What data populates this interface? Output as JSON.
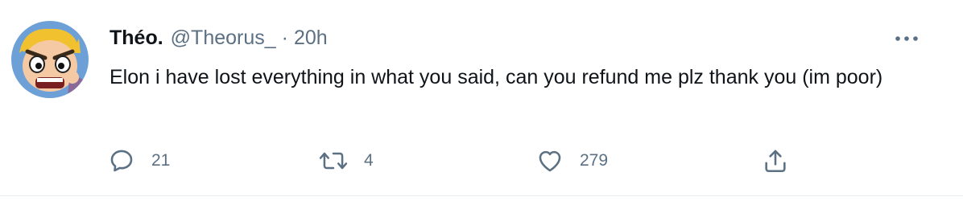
{
  "tweet": {
    "author": {
      "display_name": "Théo.",
      "handle": "@Theorus_",
      "separator": "·",
      "time": "20h",
      "avatar_icon": "cartoon-avatar-icon"
    },
    "more_icon": "more-options-icon",
    "text": "Elon i have lost everything in what you said, can you refund me plz thank you (im poor)",
    "actions": {
      "reply": {
        "icon": "reply-icon",
        "count": "21"
      },
      "retweet": {
        "icon": "retweet-icon",
        "count": "4"
      },
      "like": {
        "icon": "heart-icon",
        "count": "279"
      },
      "share": {
        "icon": "share-icon"
      }
    },
    "colors": {
      "text_primary": "#0f1419",
      "text_secondary": "#5b7083",
      "divider": "#e6ecf0"
    }
  }
}
